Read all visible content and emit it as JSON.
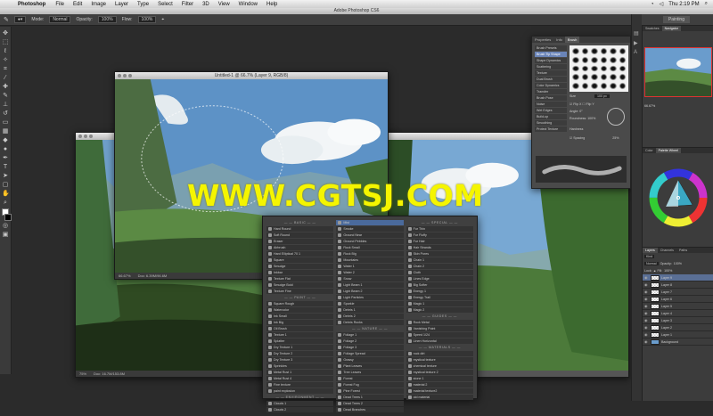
{
  "menubar": {
    "app": "Photoshop",
    "items": [
      "File",
      "Edit",
      "Image",
      "Layer",
      "Type",
      "Select",
      "Filter",
      "3D",
      "View",
      "Window",
      "Help"
    ],
    "clock": "Thu 2:19 PM"
  },
  "titlebar": {
    "title": "Adobe Photoshop CS6"
  },
  "options": {
    "mode_label": "Mode:",
    "mode": "Normal",
    "opacity_label": "Opacity:",
    "opacity": "100%",
    "flow_label": "Flow:",
    "flow": "100%",
    "workspace": "Painting"
  },
  "doc_main": {
    "title": "Untitled-1 @ 66.7% (Layer 9, RGB/8)",
    "zoom": "66.67%",
    "docsize": "Doc: 6.39M/96.6M"
  },
  "doc_back": {
    "zoom": "75%",
    "docsize": "Doc: 16.7M/153.8M"
  },
  "brush_list": {
    "col1": [
      {
        "t": "BASIC",
        "sec": true
      },
      "Hard Round",
      "Soft Round",
      "Eraser",
      "Airbrush",
      "Hard Elliptical 70 1",
      "Square",
      "Smudge",
      "Inkbar",
      "Texture Flat",
      "Smudge Bold",
      "Texture Fine",
      {
        "t": "PAINT",
        "sec": true
      },
      "Square Rough",
      "Watercolor",
      "Ink Small",
      "Ink Big",
      "Oil Brush",
      "Texture 1",
      "Splatter",
      "Dry Texture 1",
      "Dry Texture 2",
      "Dry Texture 3",
      "Sprinkles",
      "Metal Rust 1",
      "Metal Rust 4",
      "Fine texture",
      "paint explosion",
      {
        "t": "ENVIRONMENT",
        "sec": true
      },
      "Clouds 1",
      "Clouds 2"
    ],
    "col2": [
      {
        "t": "Mist",
        "sel": true
      },
      "Smoke",
      "Ground Near",
      "Ground Pebbles",
      "Rock Small",
      "Rock Big",
      "Mountains",
      "Water 1",
      "Water 2",
      "Snow",
      "Light Beam 1",
      "Light Beam 2",
      "Light Particles",
      "Sparkle",
      "Debris 1",
      "Debris 2",
      "Debris Rocks",
      {
        "t": "NATURE",
        "sec": true
      },
      "Foliage 1",
      "Foliage 2",
      "Foliage 3",
      "Foliage Spread",
      "Grassy",
      "Plant Leaves",
      "Tree Leaves",
      "Forest",
      "Forest Fog",
      "Pine Forest",
      "Dead Trees 1",
      "Dead Trees 2",
      "Dead Branches"
    ],
    "col3": [
      {
        "t": "SPECIAL",
        "sec": true
      },
      "Fur Thin",
      "Fur Fluffy",
      "Fur Hair",
      "Hair Strands",
      "Skin Pores",
      "Chain 1",
      "Chain 2",
      "Cloth",
      "Lines Edge",
      "Big Softer",
      "Energy 1",
      "Energy Trail",
      "Magic 1",
      "Magic 2",
      {
        "t": "GUIDES",
        "sec": true
      },
      "Rock Metal",
      "Vanishing Point",
      "Speed 1/24",
      "Linen Horizontal",
      {
        "t": "MATERIALS",
        "sec": true
      },
      "rock dirt",
      "mystical texture",
      "chemical texture",
      "mystical texture 2",
      "stone 1",
      "material 2",
      "material texture2",
      "old material"
    ]
  },
  "brush_panel": {
    "tabs": [
      "Properties",
      "Info",
      "Brush"
    ],
    "options": [
      "Brush Presets",
      "Brush Tip Shape",
      "Shape Dynamics",
      "Scattering",
      "Texture",
      "Dual Brush",
      "Color Dynamics",
      "Transfer",
      "Brush Pose",
      "Noise",
      "Wet Edges",
      "Build-up",
      "Smoothing",
      "Protect Texture"
    ],
    "size_label": "Size",
    "size": "100 px",
    "flip_x": "Flip X",
    "flip_y": "Flip Y",
    "angle_label": "Angle:",
    "angle": "0°",
    "roundness_label": "Roundness:",
    "roundness": "100%",
    "hardness_label": "Hardness",
    "spacing_label": "Spacing",
    "spacing": "25%"
  },
  "right_panel": {
    "nav_tabs": [
      "Swatches",
      "Navigator"
    ],
    "nav_zoom": "66.67%",
    "color_tabs": [
      "Color",
      "Palette Wheel"
    ],
    "layer_tabs": [
      "Layers",
      "Channels",
      "Paths"
    ],
    "kind": "Kind",
    "blend": "Normal",
    "opacity_label": "Opacity:",
    "opacity": "100%",
    "lock_label": "Lock:",
    "fill_label": "Fill:",
    "fill": "100%",
    "layers": [
      "Layer 9",
      "Layer 8",
      "Layer 7",
      "Layer 6",
      "Layer 5",
      "Layer 4",
      "Layer 3",
      "Layer 2",
      "Layer 1",
      "Background"
    ]
  },
  "watermark": "WWW.CGTSJ.COM",
  "colors": {
    "selection": "#5a6f95",
    "watermark": "#f5f500"
  }
}
